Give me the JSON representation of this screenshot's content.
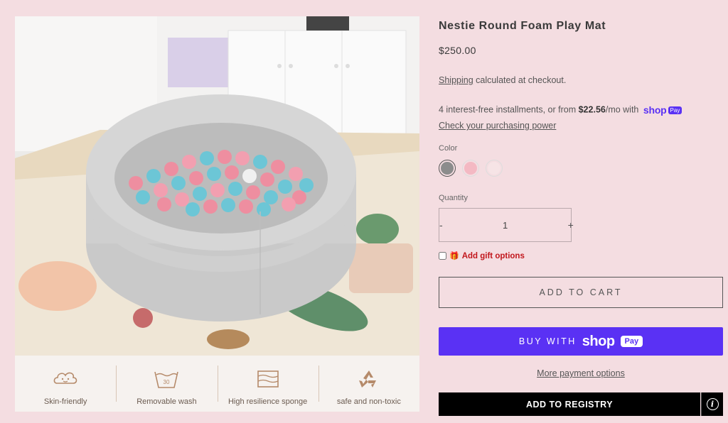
{
  "product": {
    "title": "Nestie Round Foam Play Mat",
    "price": "$250.00",
    "shipping_link": "Shipping",
    "shipping_text": " calculated at checkout.",
    "installments_prefix": "4 interest-free installments, or from ",
    "installments_amount": "$22.56",
    "installments_suffix": "/mo with",
    "shop_word": "shop",
    "pay_word": "Pay",
    "purchasing_power": "Check your purchasing power"
  },
  "color": {
    "label": "Color",
    "swatches": [
      {
        "name": "Grey",
        "hex": "#8c8c8c",
        "selected": true
      },
      {
        "name": "Pink",
        "hex": "#f4b9c3",
        "selected": false
      },
      {
        "name": "Light Pink",
        "hex": "#f6e4e6",
        "selected": false
      }
    ]
  },
  "quantity": {
    "label": "Quantity",
    "minus": "-",
    "value": "1",
    "plus": "+"
  },
  "gift": {
    "label": "Add gift options",
    "icon": "gift-icon"
  },
  "buttons": {
    "add_to_cart": "ADD TO CART",
    "buy_with": "BUY WITH",
    "shop_word": "shop",
    "pay_word": "Pay",
    "more_payment": "More payment options",
    "add_to_registry": "ADD TO REGISTRY",
    "info_icon": "info-icon"
  },
  "features": [
    {
      "icon": "cloud-face-icon",
      "label": "Skin-friendly"
    },
    {
      "icon": "wash-tub-icon",
      "label": "Removable wash",
      "icon_text": "30"
    },
    {
      "icon": "sponge-layers-icon",
      "label": "High resilience sponge"
    },
    {
      "icon": "recycle-icon",
      "label": "safe and non-toxic"
    }
  ],
  "colors": {
    "background": "#f4dde1",
    "shop_purple": "#5a31f4",
    "gift_red": "#c2161c"
  }
}
